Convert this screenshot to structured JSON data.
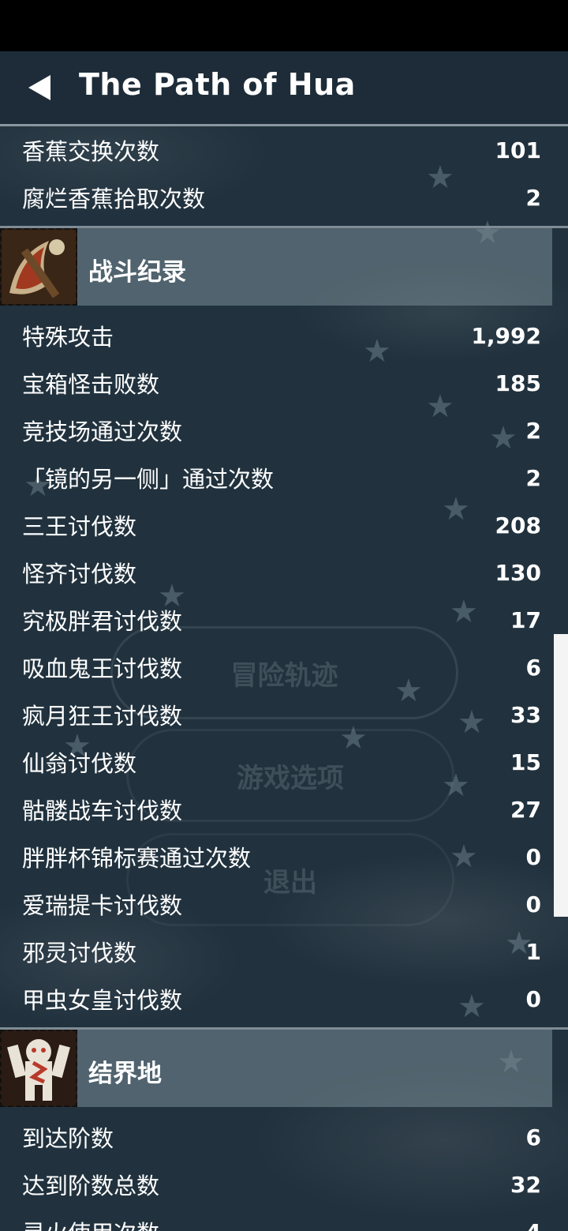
{
  "header": {
    "title": "The Path of Hua"
  },
  "ghost_menu": [
    "冒险轨迹",
    "游戏选项",
    "退出"
  ],
  "top_rows": [
    {
      "label": "香蕉交换次数",
      "value": "101"
    },
    {
      "label": "腐烂香蕉拾取次数",
      "value": "2"
    }
  ],
  "sections": [
    {
      "title": "战斗纪录",
      "icon": "axe-weapon-icon",
      "rows": [
        {
          "label": "特殊攻击",
          "value": "1,992"
        },
        {
          "label": "宝箱怪击败数",
          "value": "185"
        },
        {
          "label": "竞技场通过次数",
          "value": "2"
        },
        {
          "label": "「镜的另一侧」通过次数",
          "value": "2"
        },
        {
          "label": "三王讨伐数",
          "value": "208"
        },
        {
          "label": "怪齐讨伐数",
          "value": "130"
        },
        {
          "label": "究极胖君讨伐数",
          "value": "17"
        },
        {
          "label": "吸血鬼王讨伐数",
          "value": "6"
        },
        {
          "label": "疯月狂王讨伐数",
          "value": "33"
        },
        {
          "label": "仙翁讨伐数",
          "value": "15"
        },
        {
          "label": "骷髅战车讨伐数",
          "value": "27"
        },
        {
          "label": "胖胖杯锦标赛通过次数",
          "value": "0"
        },
        {
          "label": "爱瑞提卡讨伐数",
          "value": "0"
        },
        {
          "label": "邪灵讨伐数",
          "value": "1"
        },
        {
          "label": "甲虫女皇讨伐数",
          "value": "0"
        }
      ]
    },
    {
      "title": "结界地",
      "icon": "monkey-character-icon",
      "rows": [
        {
          "label": "到达阶数",
          "value": "6"
        },
        {
          "label": "达到阶数总数",
          "value": "32"
        },
        {
          "label": "灵火使用次数",
          "value": "4"
        }
      ]
    }
  ]
}
